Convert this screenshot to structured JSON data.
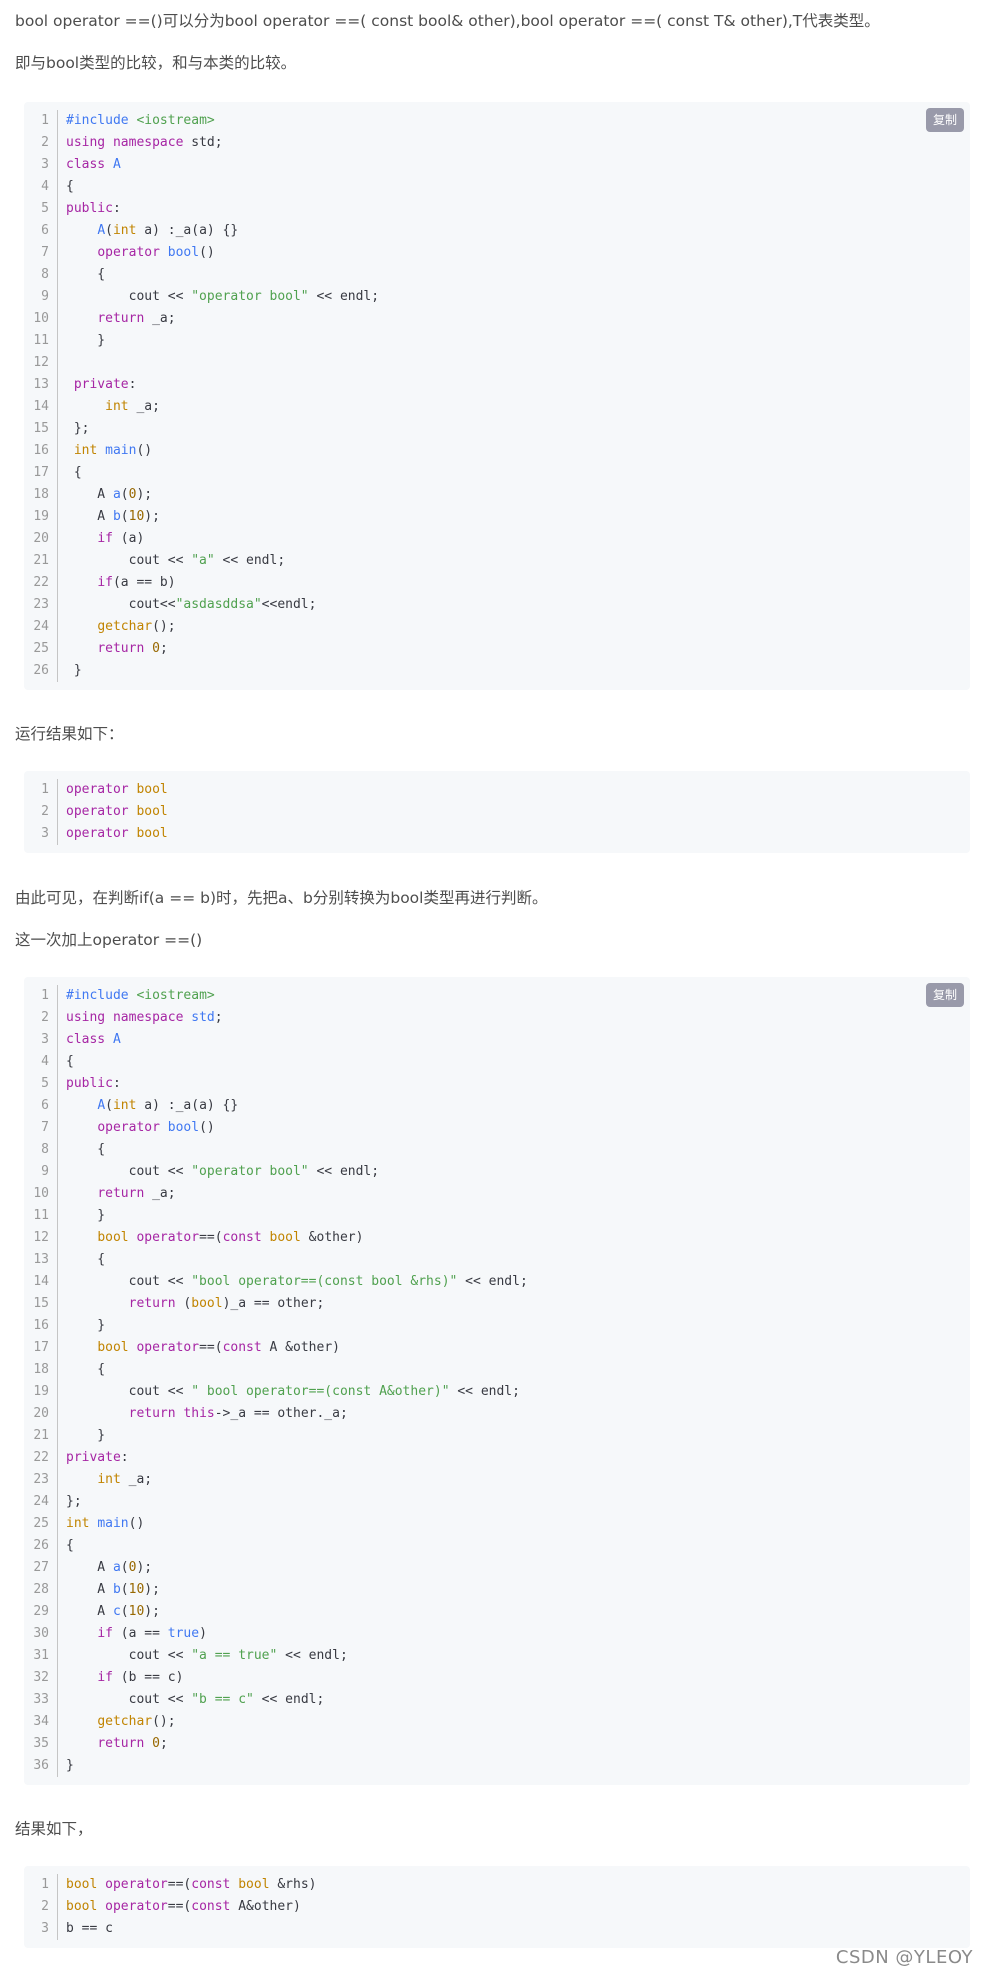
{
  "paragraphs": [
    "bool operator ==()可以分为bool operator ==( const bool& other),bool operator ==( const T& other),T代表类型。",
    "即与bool类型的比较，和与本类的比较。",
    "运行结果如下：",
    "由此可见，在判断if(a == b)时，先把a、b分别转换为bool类型再进行判断。",
    "这一次加上operator ==()",
    "结果如下，"
  ],
  "copy_label": "复制",
  "watermark": "CSDN @YLEOY",
  "code_blocks": [
    {
      "has_copy": true,
      "lines": [
        [
          [
            "mt",
            "#include "
          ],
          [
            "st",
            "<iostream>"
          ]
        ],
        [
          [
            "kw",
            "using"
          ],
          [
            "pl",
            " "
          ],
          [
            "kw",
            "namespace"
          ],
          [
            "pl",
            " std;"
          ]
        ],
        [
          [
            "kw",
            "class"
          ],
          [
            "pl",
            " "
          ],
          [
            "fn",
            "A"
          ]
        ],
        [
          [
            "pl",
            "{"
          ]
        ],
        [
          [
            "kw",
            "public"
          ],
          [
            "pl",
            ":"
          ]
        ],
        [
          [
            "pl",
            "    "
          ],
          [
            "fn",
            "A"
          ],
          [
            "pl",
            "("
          ],
          [
            "ty",
            "int"
          ],
          [
            "pl",
            " a) :_a(a) {}"
          ]
        ],
        [
          [
            "pl",
            "    "
          ],
          [
            "kw",
            "operator"
          ],
          [
            "pl",
            " "
          ],
          [
            "fn",
            "bool"
          ],
          [
            "pl",
            "()"
          ]
        ],
        [
          [
            "pl",
            "    {"
          ]
        ],
        [
          [
            "pl",
            "        cout << "
          ],
          [
            "st",
            "\"operator bool\""
          ],
          [
            "pl",
            " << endl;"
          ]
        ],
        [
          [
            "pl",
            "    "
          ],
          [
            "kw",
            "return"
          ],
          [
            "pl",
            " _a;"
          ]
        ],
        [
          [
            "pl",
            "    }"
          ]
        ],
        [
          [
            "pl",
            ""
          ]
        ],
        [
          [
            "pl",
            " "
          ],
          [
            "kw",
            "private"
          ],
          [
            "pl",
            ":"
          ]
        ],
        [
          [
            "pl",
            "     "
          ],
          [
            "ty",
            "int"
          ],
          [
            "pl",
            " _a;"
          ]
        ],
        [
          [
            "pl",
            " };"
          ]
        ],
        [
          [
            "pl",
            " "
          ],
          [
            "ty",
            "int"
          ],
          [
            "pl",
            " "
          ],
          [
            "fn",
            "main"
          ],
          [
            "pl",
            "()"
          ]
        ],
        [
          [
            "pl",
            " {"
          ]
        ],
        [
          [
            "pl",
            "    A "
          ],
          [
            "fn",
            "a"
          ],
          [
            "pl",
            "("
          ],
          [
            "nm",
            "0"
          ],
          [
            "pl",
            ");"
          ]
        ],
        [
          [
            "pl",
            "    A "
          ],
          [
            "fn",
            "b"
          ],
          [
            "pl",
            "("
          ],
          [
            "nm",
            "10"
          ],
          [
            "pl",
            ");"
          ]
        ],
        [
          [
            "pl",
            "    "
          ],
          [
            "kw",
            "if"
          ],
          [
            "pl",
            " (a)"
          ]
        ],
        [
          [
            "pl",
            "        cout << "
          ],
          [
            "st",
            "\"a\""
          ],
          [
            "pl",
            " << endl;"
          ]
        ],
        [
          [
            "pl",
            "    "
          ],
          [
            "kw",
            "if"
          ],
          [
            "pl",
            "(a == b)"
          ]
        ],
        [
          [
            "pl",
            "        cout<<"
          ],
          [
            "st",
            "\"asdasddsa\""
          ],
          [
            "pl",
            "<<endl;"
          ]
        ],
        [
          [
            "pl",
            "    "
          ],
          [
            "ty",
            "getchar"
          ],
          [
            "pl",
            "();"
          ]
        ],
        [
          [
            "pl",
            "    "
          ],
          [
            "kw",
            "return"
          ],
          [
            "pl",
            " "
          ],
          [
            "nm",
            "0"
          ],
          [
            "pl",
            ";"
          ]
        ],
        [
          [
            "pl",
            " }"
          ]
        ]
      ]
    },
    {
      "has_copy": false,
      "lines": [
        [
          [
            "kw",
            "operator"
          ],
          [
            "pl",
            " "
          ],
          [
            "ty",
            "bool"
          ]
        ],
        [
          [
            "kw",
            "operator"
          ],
          [
            "pl",
            " "
          ],
          [
            "ty",
            "bool"
          ]
        ],
        [
          [
            "kw",
            "operator"
          ],
          [
            "pl",
            " "
          ],
          [
            "ty",
            "bool"
          ]
        ]
      ]
    },
    {
      "has_copy": true,
      "lines": [
        [
          [
            "mt",
            "#include "
          ],
          [
            "st",
            "<iostream>"
          ]
        ],
        [
          [
            "kw",
            "using"
          ],
          [
            "pl",
            " "
          ],
          [
            "kw",
            "namespace"
          ],
          [
            "pl",
            " "
          ],
          [
            "fn",
            "std"
          ],
          [
            "pl",
            ";"
          ]
        ],
        [
          [
            "kw",
            "class"
          ],
          [
            "pl",
            " "
          ],
          [
            "fn",
            "A"
          ]
        ],
        [
          [
            "pl",
            "{"
          ]
        ],
        [
          [
            "kw",
            "public"
          ],
          [
            "pl",
            ":"
          ]
        ],
        [
          [
            "pl",
            "    "
          ],
          [
            "fn",
            "A"
          ],
          [
            "pl",
            "("
          ],
          [
            "ty",
            "int"
          ],
          [
            "pl",
            " a) :_a(a) {}"
          ]
        ],
        [
          [
            "pl",
            "    "
          ],
          [
            "kw",
            "operator"
          ],
          [
            "pl",
            " "
          ],
          [
            "fn",
            "bool"
          ],
          [
            "pl",
            "()"
          ]
        ],
        [
          [
            "pl",
            "    {"
          ]
        ],
        [
          [
            "pl",
            "        cout << "
          ],
          [
            "st",
            "\"operator bool\""
          ],
          [
            "pl",
            " << endl;"
          ]
        ],
        [
          [
            "pl",
            "    "
          ],
          [
            "kw",
            "return"
          ],
          [
            "pl",
            " _a;"
          ]
        ],
        [
          [
            "pl",
            "    }"
          ]
        ],
        [
          [
            "pl",
            "    "
          ],
          [
            "ty",
            "bool"
          ],
          [
            "pl",
            " "
          ],
          [
            "kw",
            "operator"
          ],
          [
            "pl",
            "==("
          ],
          [
            "kw",
            "const"
          ],
          [
            "pl",
            " "
          ],
          [
            "ty",
            "bool"
          ],
          [
            "pl",
            " &other)"
          ]
        ],
        [
          [
            "pl",
            "    {"
          ]
        ],
        [
          [
            "pl",
            "        cout << "
          ],
          [
            "st",
            "\"bool operator==(const bool &rhs)\""
          ],
          [
            "pl",
            " << endl;"
          ]
        ],
        [
          [
            "pl",
            "        "
          ],
          [
            "kw",
            "return"
          ],
          [
            "pl",
            " ("
          ],
          [
            "ty",
            "bool"
          ],
          [
            "pl",
            ")_a == other;"
          ]
        ],
        [
          [
            "pl",
            "    }"
          ]
        ],
        [
          [
            "pl",
            "    "
          ],
          [
            "ty",
            "bool"
          ],
          [
            "pl",
            " "
          ],
          [
            "kw",
            "operator"
          ],
          [
            "pl",
            "==("
          ],
          [
            "kw",
            "const"
          ],
          [
            "pl",
            " A &other)"
          ]
        ],
        [
          [
            "pl",
            "    {"
          ]
        ],
        [
          [
            "pl",
            "        cout << "
          ],
          [
            "st",
            "\" bool operator==(const A&other)\""
          ],
          [
            "pl",
            " << endl;"
          ]
        ],
        [
          [
            "pl",
            "        "
          ],
          [
            "kw",
            "return"
          ],
          [
            "pl",
            " "
          ],
          [
            "kw",
            "this"
          ],
          [
            "pl",
            "->_a == other._a;"
          ]
        ],
        [
          [
            "pl",
            "    }"
          ]
        ],
        [
          [
            "kw",
            "private"
          ],
          [
            "pl",
            ":"
          ]
        ],
        [
          [
            "pl",
            "    "
          ],
          [
            "ty",
            "int"
          ],
          [
            "pl",
            " _a;"
          ]
        ],
        [
          [
            "pl",
            "};"
          ]
        ],
        [
          [
            "ty",
            "int"
          ],
          [
            "pl",
            " "
          ],
          [
            "fn",
            "main"
          ],
          [
            "pl",
            "()"
          ]
        ],
        [
          [
            "pl",
            "{"
          ]
        ],
        [
          [
            "pl",
            "    A "
          ],
          [
            "fn",
            "a"
          ],
          [
            "pl",
            "("
          ],
          [
            "nm",
            "0"
          ],
          [
            "pl",
            ");"
          ]
        ],
        [
          [
            "pl",
            "    A "
          ],
          [
            "fn",
            "b"
          ],
          [
            "pl",
            "("
          ],
          [
            "nm",
            "10"
          ],
          [
            "pl",
            ");"
          ]
        ],
        [
          [
            "pl",
            "    A "
          ],
          [
            "fn",
            "c"
          ],
          [
            "pl",
            "("
          ],
          [
            "nm",
            "10"
          ],
          [
            "pl",
            ");"
          ]
        ],
        [
          [
            "pl",
            "    "
          ],
          [
            "kw",
            "if"
          ],
          [
            "pl",
            " (a == "
          ],
          [
            "fn",
            "true"
          ],
          [
            "pl",
            ")"
          ]
        ],
        [
          [
            "pl",
            "        cout << "
          ],
          [
            "st",
            "\"a == true\""
          ],
          [
            "pl",
            " << endl;"
          ]
        ],
        [
          [
            "pl",
            "    "
          ],
          [
            "kw",
            "if"
          ],
          [
            "pl",
            " (b == c)"
          ]
        ],
        [
          [
            "pl",
            "        cout << "
          ],
          [
            "st",
            "\"b == c\""
          ],
          [
            "pl",
            " << endl;"
          ]
        ],
        [
          [
            "pl",
            "    "
          ],
          [
            "ty",
            "getchar"
          ],
          [
            "pl",
            "();"
          ]
        ],
        [
          [
            "pl",
            "    "
          ],
          [
            "kw",
            "return"
          ],
          [
            "pl",
            " "
          ],
          [
            "nm",
            "0"
          ],
          [
            "pl",
            ";"
          ]
        ],
        [
          [
            "pl",
            "}"
          ]
        ]
      ]
    },
    {
      "has_copy": false,
      "lines": [
        [
          [
            "ty",
            "bool"
          ],
          [
            "pl",
            " "
          ],
          [
            "kw",
            "operator"
          ],
          [
            "pl",
            "==("
          ],
          [
            "kw",
            "const"
          ],
          [
            "pl",
            " "
          ],
          [
            "ty",
            "bool"
          ],
          [
            "pl",
            " &rhs)"
          ]
        ],
        [
          [
            "ty",
            "bool"
          ],
          [
            "pl",
            " "
          ],
          [
            "kw",
            "operator"
          ],
          [
            "pl",
            "==("
          ],
          [
            "kw",
            "const"
          ],
          [
            "pl",
            " A&other)"
          ]
        ],
        [
          [
            "pl",
            "b == c"
          ]
        ]
      ]
    }
  ]
}
